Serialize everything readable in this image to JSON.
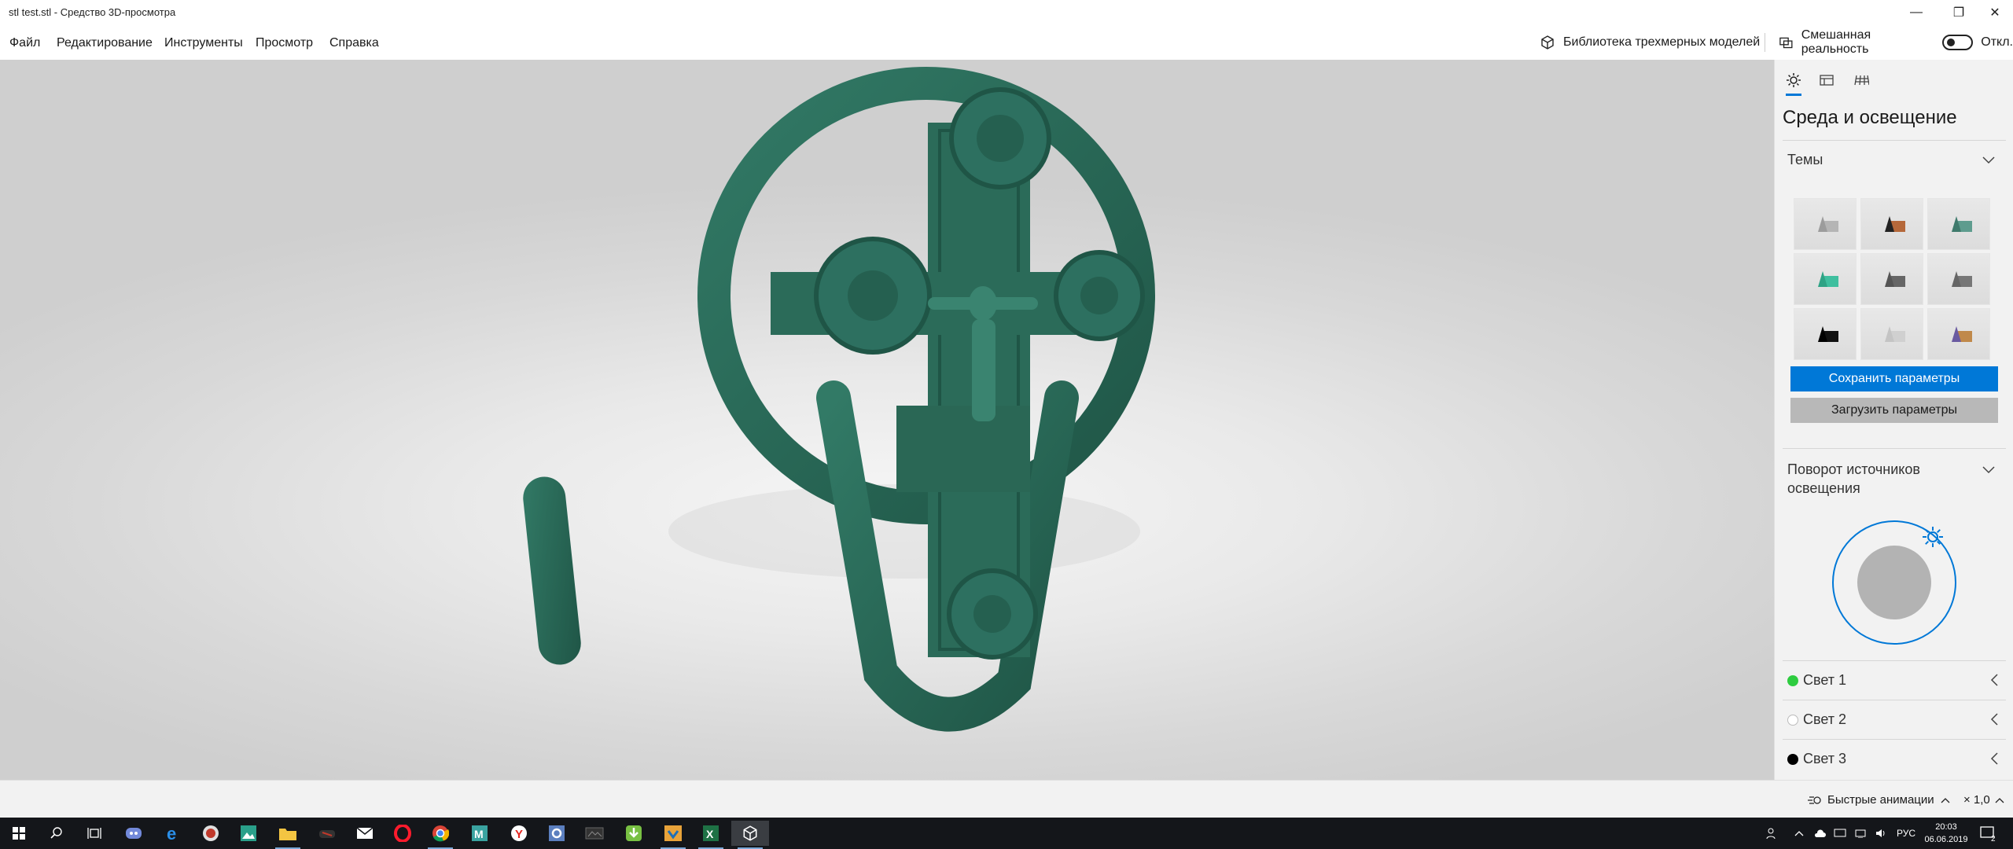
{
  "window": {
    "title": "stl test.stl - Средство 3D-просмотра",
    "minimize_glyph": "—",
    "restore_glyph": "❐",
    "close_glyph": "✕"
  },
  "menu": {
    "items": [
      "Файл",
      "Редактирование",
      "Инструменты",
      "Просмотр",
      "Справка"
    ],
    "library_label": "Библиотека трехмерных моделей",
    "mixed_reality_label": "Смешанная реальность",
    "toggle_state_label": "Откл."
  },
  "panel": {
    "title": "Среда и освещение",
    "themes_label": "Темы",
    "save_button": "Сохранить параметры",
    "load_button": "Загрузить параметры",
    "rotation_label_line1": "Поворот источников",
    "rotation_label_line2": "освещения",
    "lights": [
      {
        "label": "Свет 1",
        "color": "#2ecc40"
      },
      {
        "label": "Свет 2",
        "color": "#ffffff"
      },
      {
        "label": "Свет 3",
        "color": "#000000"
      }
    ]
  },
  "status": {
    "animations_label": "Быстрые анимации",
    "zoom_label": "× 1,0"
  },
  "taskbar": {
    "language": "РУС",
    "time": "20:03",
    "date": "06.06.2019",
    "notification_count": "2"
  },
  "colors": {
    "accent": "#0078d7",
    "model": "#2a6a58"
  }
}
